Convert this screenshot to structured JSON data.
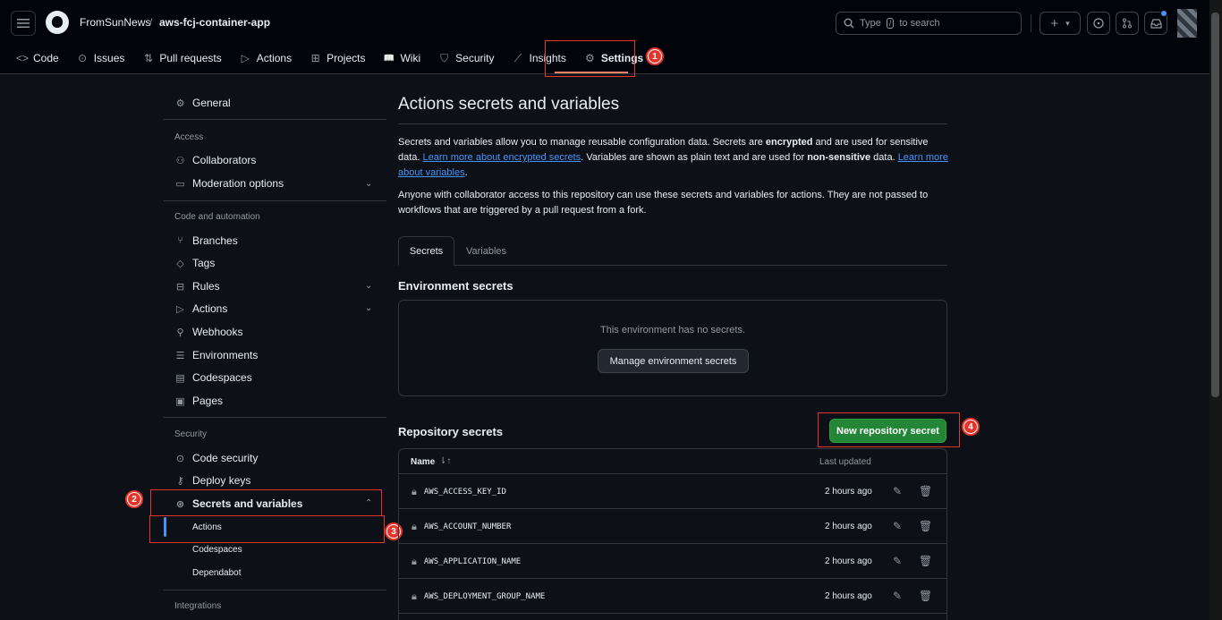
{
  "header": {
    "owner": "FromSunNews",
    "separator": "/",
    "repo": "aws-fcj-container-app",
    "search_prefix": "Type",
    "search_key": "/",
    "search_suffix": "to search",
    "plus_icon": "+",
    "caret_icon": "▾"
  },
  "nav": {
    "tabs": [
      {
        "label": "Code",
        "icon": "<>"
      },
      {
        "label": "Issues",
        "icon": "⊙"
      },
      {
        "label": "Pull requests",
        "icon": "⇅"
      },
      {
        "label": "Actions",
        "icon": "▷"
      },
      {
        "label": "Projects",
        "icon": "⊞"
      },
      {
        "label": "Wiki",
        "icon": "📖"
      },
      {
        "label": "Security",
        "icon": "⛉"
      },
      {
        "label": "Insights",
        "icon": "⟋"
      },
      {
        "label": "Settings",
        "icon": "⚙"
      }
    ]
  },
  "badges": [
    "1",
    "2",
    "3",
    "4"
  ],
  "sidebar": {
    "general": "General",
    "access_heading": "Access",
    "collaborators": "Collaborators",
    "moderation": "Moderation options",
    "code_heading": "Code and automation",
    "branches": "Branches",
    "tags": "Tags",
    "rules": "Rules",
    "actions": "Actions",
    "webhooks": "Webhooks",
    "environments": "Environments",
    "codespaces": "Codespaces",
    "pages": "Pages",
    "security_heading": "Security",
    "code_security": "Code security",
    "deploy_keys": "Deploy keys",
    "secrets_vars": "Secrets and variables",
    "sub_actions": "Actions",
    "sub_codespaces": "Codespaces",
    "sub_dependabot": "Dependabot",
    "integrations_heading": "Integrations"
  },
  "main": {
    "title": "Actions secrets and variables",
    "p1_a": "Secrets and variables allow you to manage reusable configuration data. Secrets are ",
    "p1_b": "encrypted",
    "p1_c": " and are used for sensitive data. ",
    "p1_link1": "Learn more about encrypted secrets",
    "p1_d": ". Variables are shown as plain text and are used for ",
    "p1_e": "non-sensitive",
    "p1_f": " data. ",
    "p1_link2": "Learn more about variables",
    "p1_g": ".",
    "p2": "Anyone with collaborator access to this repository can use these secrets and variables for actions. They are not passed to workflows that are triggered by a pull request from a fork.",
    "tab_secrets": "Secrets",
    "tab_variables": "Variables",
    "env_heading": "Environment secrets",
    "env_empty": "This environment has no secrets.",
    "manage_env_btn": "Manage environment secrets",
    "repo_heading": "Repository secrets",
    "new_secret_btn": "New repository secret",
    "col_name": "Name",
    "sort_icon": "⇂↑",
    "col_updated": "Last updated",
    "secrets": [
      {
        "name": "AWS_ACCESS_KEY_ID",
        "updated": "2 hours ago"
      },
      {
        "name": "AWS_ACCOUNT_NUMBER",
        "updated": "2 hours ago"
      },
      {
        "name": "AWS_APPLICATION_NAME",
        "updated": "2 hours ago"
      },
      {
        "name": "AWS_DEPLOYMENT_GROUP_NAME",
        "updated": "2 hours ago"
      }
    ]
  }
}
